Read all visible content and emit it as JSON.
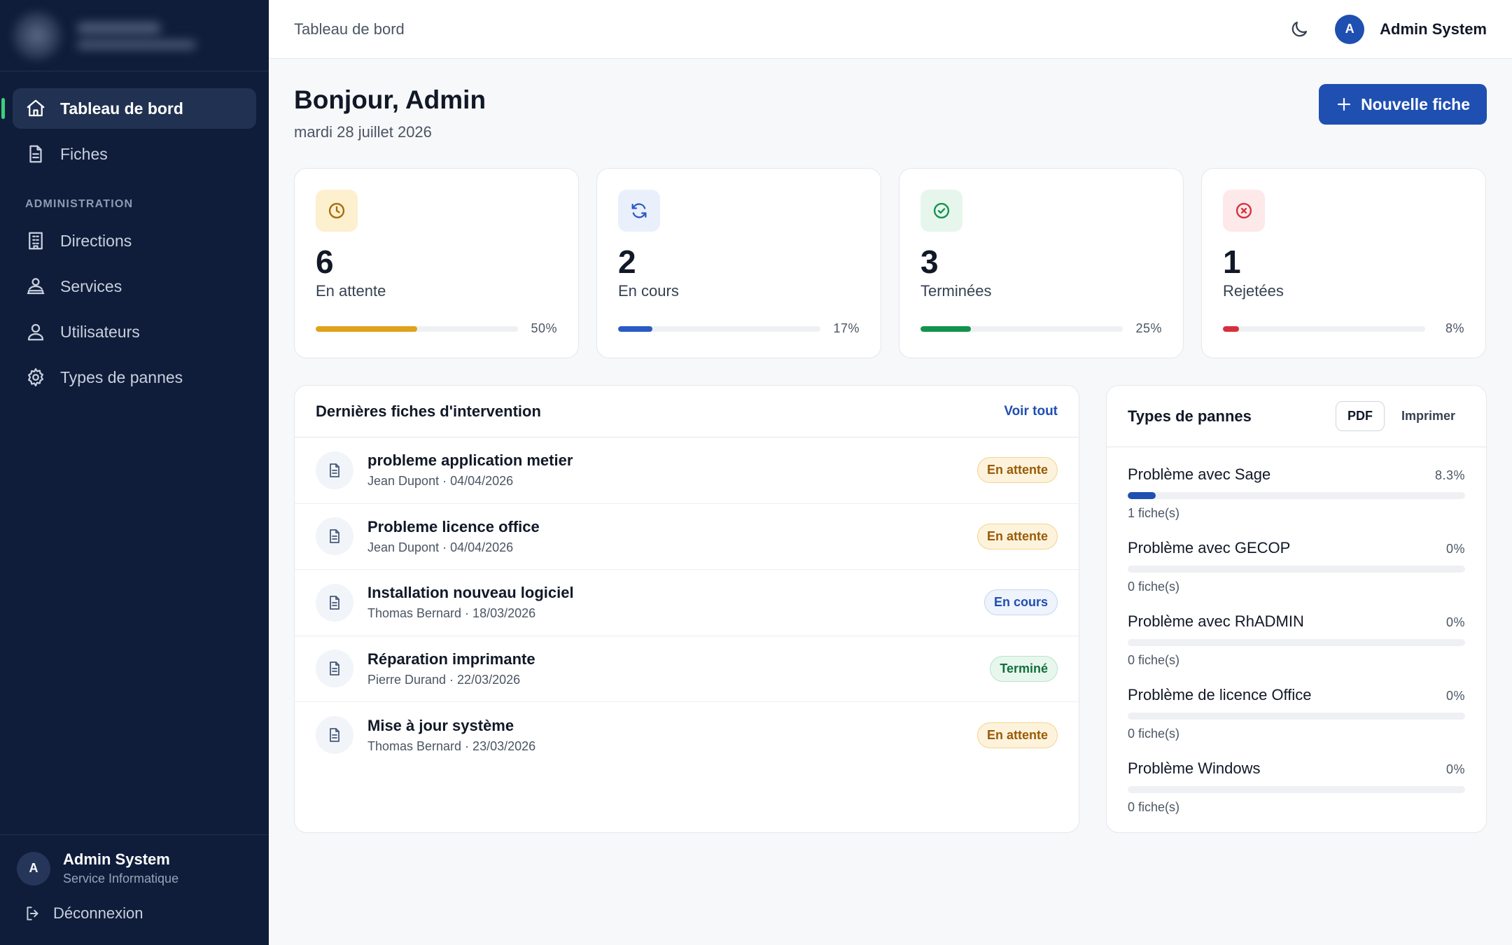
{
  "sidebar": {
    "nav": [
      {
        "label": "Tableau de bord",
        "icon": "home-icon",
        "active": true
      },
      {
        "label": "Fiches",
        "icon": "document-icon",
        "active": false
      }
    ],
    "section_label": "ADMINISTRATION",
    "admin": [
      {
        "label": "Directions",
        "icon": "building-icon"
      },
      {
        "label": "Services",
        "icon": "services-icon"
      },
      {
        "label": "Utilisateurs",
        "icon": "users-icon"
      },
      {
        "label": "Types de pannes",
        "icon": "gear-icon"
      }
    ],
    "user": {
      "initial": "A",
      "name": "Admin System",
      "role": "Service Informatique"
    },
    "logout_label": "Déconnexion"
  },
  "header": {
    "breadcrumb": "Tableau de bord",
    "user_initial": "A",
    "user_name": "Admin System"
  },
  "main": {
    "greeting": "Bonjour, Admin",
    "date": "mardi 28 juillet 2026",
    "new_button_label": "Nouvelle fiche",
    "stats": [
      {
        "value": "6",
        "label": "En attente",
        "percent": "50%",
        "fraction": 0.5,
        "color": "#e0a21b",
        "bg": "#fdf0cf",
        "icon": "clock-icon"
      },
      {
        "value": "2",
        "label": "En cours",
        "percent": "17%",
        "fraction": 0.17,
        "color": "#2a5bc4",
        "bg": "#eaf0fb",
        "icon": "refresh-icon"
      },
      {
        "value": "3",
        "label": "Terminées",
        "percent": "25%",
        "fraction": 0.25,
        "color": "#13924e",
        "bg": "#e6f6ec",
        "icon": "check-circle-icon"
      },
      {
        "value": "1",
        "label": "Rejetées",
        "percent": "8%",
        "fraction": 0.08,
        "color": "#d7303c",
        "bg": "#fde8ea",
        "icon": "x-circle-icon"
      }
    ],
    "recent": {
      "title": "Dernières fiches d'intervention",
      "link_label": "Voir tout",
      "rows": [
        {
          "title": "probleme application metier",
          "meta": "Jean Dupont · 04/04/2026",
          "status": "En attente",
          "status_kind": "att"
        },
        {
          "title": "Probleme licence office",
          "meta": "Jean Dupont · 04/04/2026",
          "status": "En attente",
          "status_kind": "att"
        },
        {
          "title": "Installation nouveau logiciel",
          "meta": "Thomas Bernard · 18/03/2026",
          "status": "En cours",
          "status_kind": "cours"
        },
        {
          "title": "Réparation imprimante",
          "meta": "Pierre Durand · 22/03/2026",
          "status": "Terminé",
          "status_kind": "term"
        },
        {
          "title": "Mise à jour système",
          "meta": "Thomas Bernard · 23/03/2026",
          "status": "En attente",
          "status_kind": "att"
        }
      ]
    },
    "types": {
      "title": "Types de pannes",
      "pdf_label": "PDF",
      "print_label": "Imprimer",
      "items": [
        {
          "name": "Problème avec Sage",
          "percent": "8.3%",
          "fraction": 0.083,
          "count": "1 fiche(s)"
        },
        {
          "name": "Problème avec GECOP",
          "percent": "0%",
          "fraction": 0,
          "count": "0 fiche(s)"
        },
        {
          "name": "Problème avec RhADMIN",
          "percent": "0%",
          "fraction": 0,
          "count": "0 fiche(s)"
        },
        {
          "name": "Problème de licence Office",
          "percent": "0%",
          "fraction": 0,
          "count": "0 fiche(s)"
        },
        {
          "name": "Problème Windows",
          "percent": "0%",
          "fraction": 0,
          "count": "0 fiche(s)"
        }
      ]
    }
  }
}
